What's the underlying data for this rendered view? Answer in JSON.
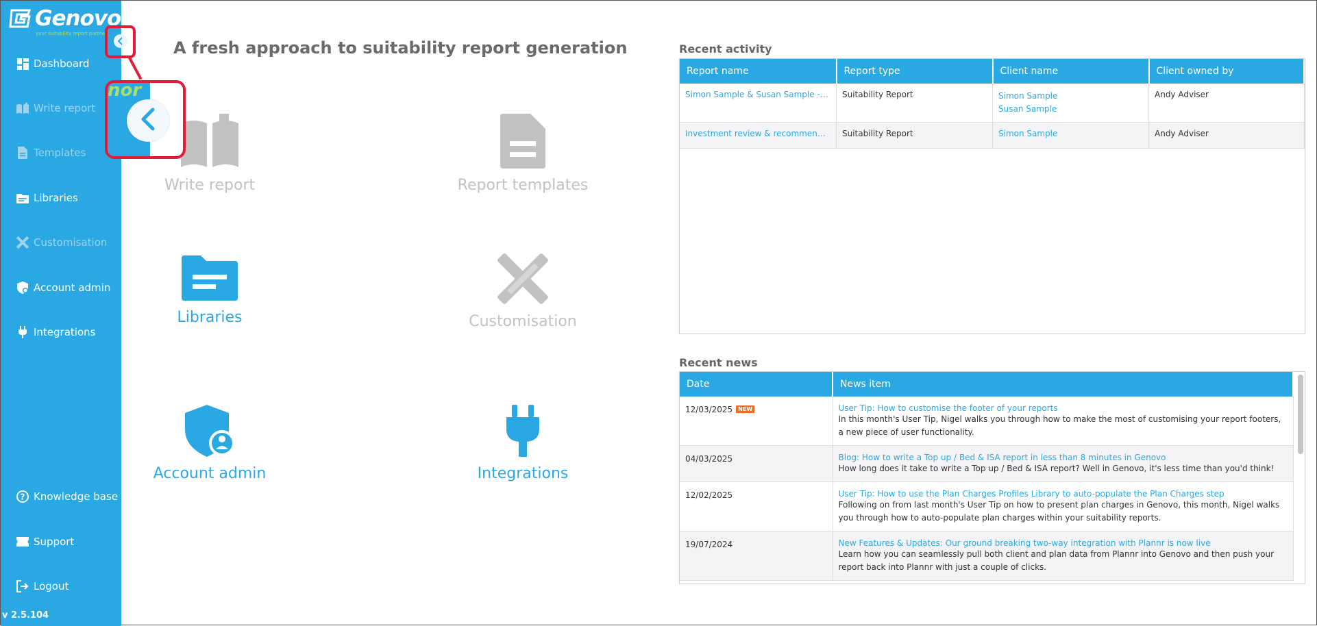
{
  "sidebar": {
    "logo_text": "Genovo",
    "logo_tagline": "your suitability report partner",
    "items": [
      {
        "label": "Dashboard",
        "icon": "dashboard-icon"
      },
      {
        "label": "Write report",
        "icon": "book-icon"
      },
      {
        "label": "Templates",
        "icon": "document-icon"
      },
      {
        "label": "Libraries",
        "icon": "folder-icon"
      },
      {
        "label": "Customisation",
        "icon": "tools-icon"
      },
      {
        "label": "Account admin",
        "icon": "shield-user-icon"
      },
      {
        "label": "Integrations",
        "icon": "plug-icon"
      }
    ],
    "bottom_items": [
      {
        "label": "Knowledge base",
        "icon": "help-circle-icon"
      },
      {
        "label": "Support",
        "icon": "ticket-icon"
      },
      {
        "label": "Logout",
        "icon": "logout-icon"
      }
    ],
    "version": "v 2.5.104"
  },
  "annotation": {
    "zoom_text": "nor"
  },
  "main": {
    "headline": "A fresh approach to suitability report generation",
    "tiles": [
      {
        "label": "Write report",
        "icon": "book-icon",
        "enabled": false
      },
      {
        "label": "Report templates",
        "icon": "document-icon",
        "enabled": false
      },
      {
        "label": "Libraries",
        "icon": "folder-icon",
        "enabled": true
      },
      {
        "label": "Customisation",
        "icon": "tools-icon",
        "enabled": false
      },
      {
        "label": "Account admin",
        "icon": "shield-user-icon",
        "enabled": true
      },
      {
        "label": "Integrations",
        "icon": "plug-icon",
        "enabled": true
      }
    ]
  },
  "recent_activity": {
    "title": "Recent activity",
    "columns": [
      "Report name",
      "Report type",
      "Client name",
      "Client owned by"
    ],
    "rows": [
      {
        "report_name": "Simon Sample & Susan Sample - Su...",
        "report_type": "Suitability Report",
        "clients": [
          "Simon Sample",
          "Susan Sample"
        ],
        "owner": "Andy Adviser"
      },
      {
        "report_name": "Investment review & recommendat...",
        "report_type": "Suitability Report",
        "clients": [
          "Simon Sample"
        ],
        "owner": "Andy Adviser"
      }
    ]
  },
  "recent_news": {
    "title": "Recent news",
    "columns": [
      "Date",
      "News item"
    ],
    "new_badge": "NEW",
    "rows": [
      {
        "date": "12/03/2025",
        "is_new": true,
        "title": "User Tip: How to customise the footer of your reports",
        "desc": "In this month's User Tip, Nigel walks you through how to make the most of customising your report footers, a new piece of user functionality."
      },
      {
        "date": "04/03/2025",
        "is_new": false,
        "title": "Blog: How to write a Top up / Bed & ISA report in less than 8 minutes in Genovo",
        "desc": "How long does it take to write a Top up / Bed & ISA report? Well in Genovo, it's less time than you'd think!"
      },
      {
        "date": "12/02/2025",
        "is_new": false,
        "title": "User Tip: How to use the Plan Charges Profiles Library to auto-populate the Plan Charges step",
        "desc": "Following on from last month's User Tip on how to present plan charges in Genovo, this month, Nigel walks you through how to auto-populate plan charges within your suitability reports."
      },
      {
        "date": "19/07/2024",
        "is_new": false,
        "title": "New Features & Updates: Our ground breaking two-way integration with Plannr is now live",
        "desc": "Learn how you can seamlessly pull both client and plan data from Plannr into Genovo and then push your report back into Plannr with just a couple of clicks."
      }
    ]
  },
  "colors": {
    "brand": "#2aa8e3",
    "accent_green": "#a6e06a",
    "callout": "#e31b36",
    "disabled": "#c2c2c2",
    "new_badge": "#f26b24"
  }
}
